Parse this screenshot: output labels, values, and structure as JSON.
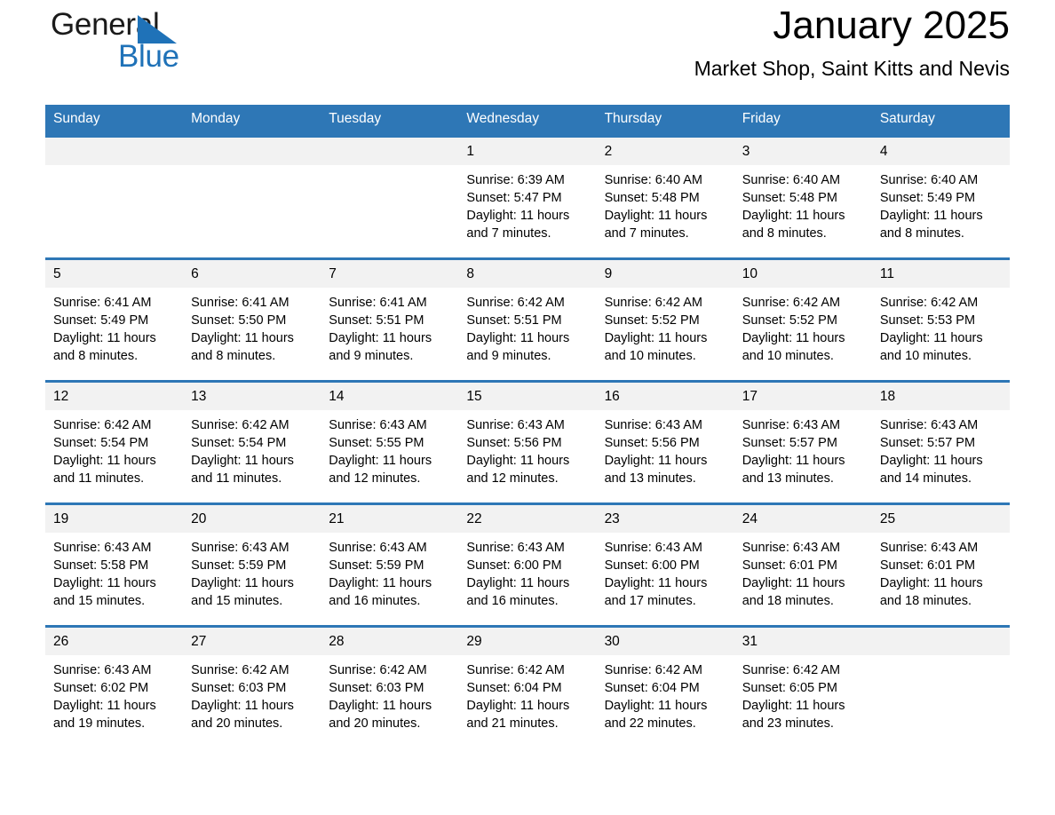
{
  "brand": {
    "word_one": "General",
    "word_two": "Blue",
    "mark": "triangle-logo-icon",
    "accent_color": "#1f72b8"
  },
  "header": {
    "month_title": "January 2025",
    "location_title": "Market Shop, Saint Kitts and Nevis"
  },
  "calendar": {
    "header_color": "#2e77b6",
    "daynum_band_color": "#f2f2f2",
    "weekday_headers": [
      "Sunday",
      "Monday",
      "Tuesday",
      "Wednesday",
      "Thursday",
      "Friday",
      "Saturday"
    ],
    "weeks": [
      [
        {
          "day": "",
          "sunrise": "",
          "sunset": "",
          "daylight": ""
        },
        {
          "day": "",
          "sunrise": "",
          "sunset": "",
          "daylight": ""
        },
        {
          "day": "",
          "sunrise": "",
          "sunset": "",
          "daylight": ""
        },
        {
          "day": "1",
          "sunrise": "Sunrise: 6:39 AM",
          "sunset": "Sunset: 5:47 PM",
          "daylight": "Daylight: 11 hours and 7 minutes."
        },
        {
          "day": "2",
          "sunrise": "Sunrise: 6:40 AM",
          "sunset": "Sunset: 5:48 PM",
          "daylight": "Daylight: 11 hours and 7 minutes."
        },
        {
          "day": "3",
          "sunrise": "Sunrise: 6:40 AM",
          "sunset": "Sunset: 5:48 PM",
          "daylight": "Daylight: 11 hours and 8 minutes."
        },
        {
          "day": "4",
          "sunrise": "Sunrise: 6:40 AM",
          "sunset": "Sunset: 5:49 PM",
          "daylight": "Daylight: 11 hours and 8 minutes."
        }
      ],
      [
        {
          "day": "5",
          "sunrise": "Sunrise: 6:41 AM",
          "sunset": "Sunset: 5:49 PM",
          "daylight": "Daylight: 11 hours and 8 minutes."
        },
        {
          "day": "6",
          "sunrise": "Sunrise: 6:41 AM",
          "sunset": "Sunset: 5:50 PM",
          "daylight": "Daylight: 11 hours and 8 minutes."
        },
        {
          "day": "7",
          "sunrise": "Sunrise: 6:41 AM",
          "sunset": "Sunset: 5:51 PM",
          "daylight": "Daylight: 11 hours and 9 minutes."
        },
        {
          "day": "8",
          "sunrise": "Sunrise: 6:42 AM",
          "sunset": "Sunset: 5:51 PM",
          "daylight": "Daylight: 11 hours and 9 minutes."
        },
        {
          "day": "9",
          "sunrise": "Sunrise: 6:42 AM",
          "sunset": "Sunset: 5:52 PM",
          "daylight": "Daylight: 11 hours and 10 minutes."
        },
        {
          "day": "10",
          "sunrise": "Sunrise: 6:42 AM",
          "sunset": "Sunset: 5:52 PM",
          "daylight": "Daylight: 11 hours and 10 minutes."
        },
        {
          "day": "11",
          "sunrise": "Sunrise: 6:42 AM",
          "sunset": "Sunset: 5:53 PM",
          "daylight": "Daylight: 11 hours and 10 minutes."
        }
      ],
      [
        {
          "day": "12",
          "sunrise": "Sunrise: 6:42 AM",
          "sunset": "Sunset: 5:54 PM",
          "daylight": "Daylight: 11 hours and 11 minutes."
        },
        {
          "day": "13",
          "sunrise": "Sunrise: 6:42 AM",
          "sunset": "Sunset: 5:54 PM",
          "daylight": "Daylight: 11 hours and 11 minutes."
        },
        {
          "day": "14",
          "sunrise": "Sunrise: 6:43 AM",
          "sunset": "Sunset: 5:55 PM",
          "daylight": "Daylight: 11 hours and 12 minutes."
        },
        {
          "day": "15",
          "sunrise": "Sunrise: 6:43 AM",
          "sunset": "Sunset: 5:56 PM",
          "daylight": "Daylight: 11 hours and 12 minutes."
        },
        {
          "day": "16",
          "sunrise": "Sunrise: 6:43 AM",
          "sunset": "Sunset: 5:56 PM",
          "daylight": "Daylight: 11 hours and 13 minutes."
        },
        {
          "day": "17",
          "sunrise": "Sunrise: 6:43 AM",
          "sunset": "Sunset: 5:57 PM",
          "daylight": "Daylight: 11 hours and 13 minutes."
        },
        {
          "day": "18",
          "sunrise": "Sunrise: 6:43 AM",
          "sunset": "Sunset: 5:57 PM",
          "daylight": "Daylight: 11 hours and 14 minutes."
        }
      ],
      [
        {
          "day": "19",
          "sunrise": "Sunrise: 6:43 AM",
          "sunset": "Sunset: 5:58 PM",
          "daylight": "Daylight: 11 hours and 15 minutes."
        },
        {
          "day": "20",
          "sunrise": "Sunrise: 6:43 AM",
          "sunset": "Sunset: 5:59 PM",
          "daylight": "Daylight: 11 hours and 15 minutes."
        },
        {
          "day": "21",
          "sunrise": "Sunrise: 6:43 AM",
          "sunset": "Sunset: 5:59 PM",
          "daylight": "Daylight: 11 hours and 16 minutes."
        },
        {
          "day": "22",
          "sunrise": "Sunrise: 6:43 AM",
          "sunset": "Sunset: 6:00 PM",
          "daylight": "Daylight: 11 hours and 16 minutes."
        },
        {
          "day": "23",
          "sunrise": "Sunrise: 6:43 AM",
          "sunset": "Sunset: 6:00 PM",
          "daylight": "Daylight: 11 hours and 17 minutes."
        },
        {
          "day": "24",
          "sunrise": "Sunrise: 6:43 AM",
          "sunset": "Sunset: 6:01 PM",
          "daylight": "Daylight: 11 hours and 18 minutes."
        },
        {
          "day": "25",
          "sunrise": "Sunrise: 6:43 AM",
          "sunset": "Sunset: 6:01 PM",
          "daylight": "Daylight: 11 hours and 18 minutes."
        }
      ],
      [
        {
          "day": "26",
          "sunrise": "Sunrise: 6:43 AM",
          "sunset": "Sunset: 6:02 PM",
          "daylight": "Daylight: 11 hours and 19 minutes."
        },
        {
          "day": "27",
          "sunrise": "Sunrise: 6:42 AM",
          "sunset": "Sunset: 6:03 PM",
          "daylight": "Daylight: 11 hours and 20 minutes."
        },
        {
          "day": "28",
          "sunrise": "Sunrise: 6:42 AM",
          "sunset": "Sunset: 6:03 PM",
          "daylight": "Daylight: 11 hours and 20 minutes."
        },
        {
          "day": "29",
          "sunrise": "Sunrise: 6:42 AM",
          "sunset": "Sunset: 6:04 PM",
          "daylight": "Daylight: 11 hours and 21 minutes."
        },
        {
          "day": "30",
          "sunrise": "Sunrise: 6:42 AM",
          "sunset": "Sunset: 6:04 PM",
          "daylight": "Daylight: 11 hours and 22 minutes."
        },
        {
          "day": "31",
          "sunrise": "Sunrise: 6:42 AM",
          "sunset": "Sunset: 6:05 PM",
          "daylight": "Daylight: 11 hours and 23 minutes."
        },
        {
          "day": "",
          "sunrise": "",
          "sunset": "",
          "daylight": ""
        }
      ]
    ]
  }
}
